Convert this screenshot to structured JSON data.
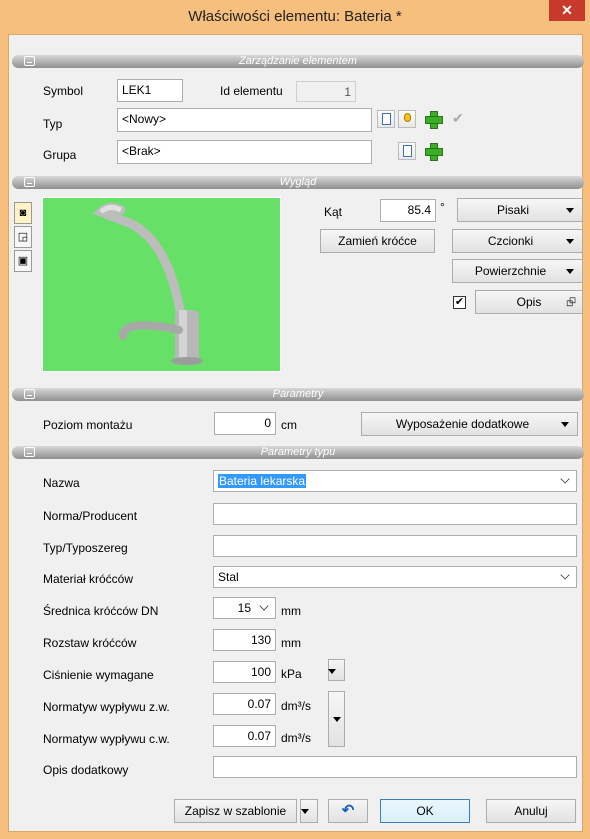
{
  "window": {
    "title": "Właściwości elementu: Bateria *",
    "close_glyph": "✕"
  },
  "sections": {
    "zarzadzanie": "Zarządzanie elementem",
    "wyglad": "Wygląd",
    "parametry": "Parametry",
    "parametry_typu": "Parametry typu"
  },
  "zarzadzanie": {
    "symbol_label": "Symbol",
    "symbol_value": "LEK1",
    "id_label": "Id elementu",
    "id_value": "1",
    "typ_label": "Typ",
    "typ_value": "<Nowy>",
    "grupa_label": "Grupa",
    "grupa_value": "<Brak>",
    "icons": {
      "doc": "document-icon",
      "bulb": "lightbulb-icon",
      "add": "plus-icon",
      "ok": "checkmark-icon"
    }
  },
  "wyglad": {
    "kat_label": "Kąt",
    "kat_value": "85.4",
    "kat_unit": "°",
    "pisaki": "Pisaki",
    "zamien": "Zamień króćce",
    "czcionki": "Czcionki",
    "powierzchnie": "Powierzchnie",
    "opis": "Opis",
    "opis_checked": true,
    "preview_bg": "#66e066"
  },
  "parametry": {
    "poziom_label": "Poziom montażu",
    "poziom_value": "0",
    "poziom_unit": "cm",
    "wyposazenie": "Wyposażenie dodatkowe"
  },
  "parametry_typu": {
    "nazwa_label": "Nazwa",
    "nazwa_value": "Bateria lekarska",
    "norma_label": "Norma/Producent",
    "norma_value": "",
    "typ_label": "Typ/Typoszereg",
    "typ_value": "",
    "material_label": "Materiał króćców",
    "material_value": "Stal",
    "srednica_label": "Średnica króćców DN",
    "srednica_value": "15",
    "srednica_unit": "mm",
    "rozstaw_label": "Rozstaw króćców",
    "rozstaw_value": "130",
    "rozstaw_unit": "mm",
    "cisnienie_label": "Ciśnienie wymagane",
    "cisnienie_value": "100",
    "cisnienie_unit": "kPa",
    "normatyw_zw_label": "Normatyw wypływu z.w.",
    "normatyw_zw_value": "0.07",
    "normatyw_zw_unit": "dm³/s",
    "normatyw_cw_label": "Normatyw wypływu c.w.",
    "normatyw_cw_value": "0.07",
    "normatyw_cw_unit": "dm³/s",
    "opis_label": "Opis dodatkowy",
    "opis_value": ""
  },
  "footer": {
    "zapisz": "Zapisz w szablonie",
    "ok": "OK",
    "anuluj": "Anuluj"
  }
}
